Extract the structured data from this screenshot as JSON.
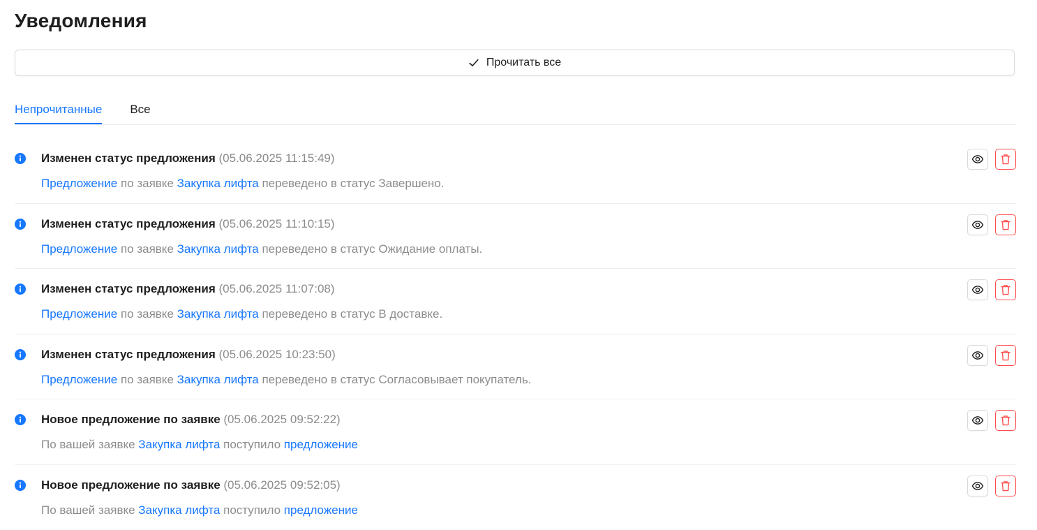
{
  "page": {
    "title": "Уведомления"
  },
  "actions": {
    "read_all_label": "Прочитать все"
  },
  "tabs": [
    {
      "label": "Непрочитанные",
      "active": true
    },
    {
      "label": "Все",
      "active": false
    }
  ],
  "colors": {
    "accent": "#1677ff",
    "danger": "#ff4d4f",
    "muted": "#8c8c8c"
  },
  "icons": {
    "info": "info-icon",
    "view": "eye-icon",
    "delete": "trash-icon",
    "read_all": "check-icon"
  },
  "notifications": [
    {
      "title": "Изменен статус предложения",
      "time": "(05.06.2025 11:15:49)",
      "parts": [
        {
          "text": "Предложение",
          "link": true
        },
        {
          "text": " по заявке ",
          "link": false
        },
        {
          "text": "Закупка лифта",
          "link": true
        },
        {
          "text": " переведено в статус Завершено.",
          "link": false
        }
      ]
    },
    {
      "title": "Изменен статус предложения",
      "time": "(05.06.2025 11:10:15)",
      "parts": [
        {
          "text": "Предложение",
          "link": true
        },
        {
          "text": " по заявке ",
          "link": false
        },
        {
          "text": "Закупка лифта",
          "link": true
        },
        {
          "text": " переведено в статус Ожидание оплаты.",
          "link": false
        }
      ]
    },
    {
      "title": "Изменен статус предложения",
      "time": "(05.06.2025 11:07:08)",
      "parts": [
        {
          "text": "Предложение",
          "link": true
        },
        {
          "text": " по заявке ",
          "link": false
        },
        {
          "text": "Закупка лифта",
          "link": true
        },
        {
          "text": " переведено в статус В доставке.",
          "link": false
        }
      ]
    },
    {
      "title": "Изменен статус предложения",
      "time": "(05.06.2025 10:23:50)",
      "parts": [
        {
          "text": "Предложение",
          "link": true
        },
        {
          "text": " по заявке ",
          "link": false
        },
        {
          "text": "Закупка лифта",
          "link": true
        },
        {
          "text": " переведено в статус Согласовывает покупатель.",
          "link": false
        }
      ]
    },
    {
      "title": "Новое предложение по заявке",
      "time": "(05.06.2025 09:52:22)",
      "parts": [
        {
          "text": "По вашей заявке ",
          "link": false
        },
        {
          "text": "Закупка лифта",
          "link": true
        },
        {
          "text": " поступило ",
          "link": false
        },
        {
          "text": "предложение",
          "link": true
        }
      ]
    },
    {
      "title": "Новое предложение по заявке",
      "time": "(05.06.2025 09:52:05)",
      "parts": [
        {
          "text": "По вашей заявке ",
          "link": false
        },
        {
          "text": "Закупка лифта",
          "link": true
        },
        {
          "text": " поступило ",
          "link": false
        },
        {
          "text": "предложение",
          "link": true
        }
      ]
    }
  ]
}
